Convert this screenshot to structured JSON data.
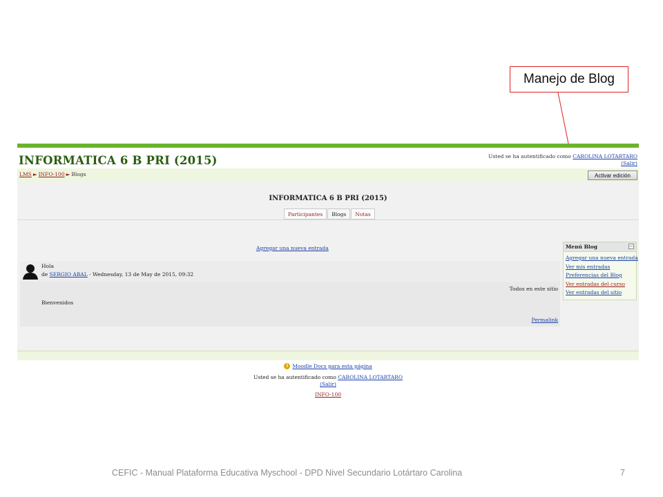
{
  "callout": {
    "label": "Manejo de Blog"
  },
  "header": {
    "site_title": "INFORMATICA 6 B PRI (2015)",
    "login_prefix": "Usted se ha autentificado como ",
    "user_name": "CAROLINA LOTARTARO",
    "logout": "(Salir)"
  },
  "breadcrumb": {
    "items": [
      "LMS",
      "INFO-100",
      "Blogs"
    ],
    "separator": "►"
  },
  "edit_button": "Activar edición",
  "course_title": "INFORMATICA 6 B PRI (2015)",
  "tabs": [
    {
      "label": "Participantes"
    },
    {
      "label": "Blogs"
    },
    {
      "label": "Notas"
    }
  ],
  "add_entry_link": "Agregar una nueva entrada",
  "post": {
    "subject": "Hola",
    "author_prefix": "de ",
    "author": "SERGIO ABAL",
    "date": " - Wednesday, 13 de May de 2015, 09:32",
    "scope": "Todos en este sitio",
    "body": "Bienvenidos",
    "permalink": "Permalink"
  },
  "blog_menu": {
    "title": "Menú Blog",
    "items": [
      {
        "label": "Agregar una nueva entrada"
      },
      {
        "label": "Ver mis entradas"
      },
      {
        "label": "Preferencias del Blog"
      },
      {
        "label": "Ver entradas del curso"
      },
      {
        "label": "Ver entradas del sitio"
      }
    ]
  },
  "footer": {
    "docs_link": "Moodle Docs para esta página",
    "login_prefix": "Usted se ha autentificado como ",
    "user_name": "CAROLINA LOTARTARO",
    "logout": "(Salir)",
    "course_link": "INFO-100"
  },
  "slide_footer": {
    "text": "CEFIC - Manual Plataforma Educativa Myschool - DPD Nivel Secundario Lotártaro Carolina",
    "page_number": "7"
  },
  "colors": {
    "accent_green": "#6ab42c",
    "link_blue": "#1a3fa8",
    "link_red": "#9a1b1b",
    "callout_red": "#e02020"
  }
}
